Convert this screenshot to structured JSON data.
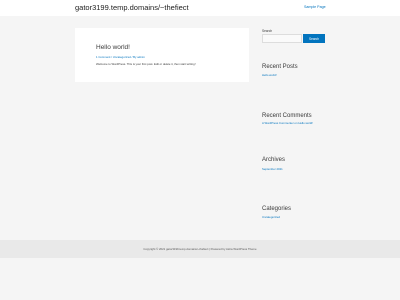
{
  "header": {
    "site_title": "gator3199.temp.domains/~thefiect",
    "nav_link": "Sample Page"
  },
  "post": {
    "title": "Hello world!",
    "meta": "1 Comment / Uncategorized / By admin",
    "excerpt": "Welcome to WordPress. This is your first post. Edit or delete it, then start writing!"
  },
  "sidebar": {
    "search": {
      "label": "Search",
      "placeholder": "",
      "button_label": "Search"
    },
    "recent_posts": {
      "title": "Recent Posts",
      "items": [
        "Hello world!"
      ]
    },
    "recent_comments": {
      "title": "Recent Comments",
      "items": [
        "A WordPress Commenter on Hello world!"
      ]
    },
    "archives": {
      "title": "Archives",
      "items": [
        "September 2021"
      ]
    },
    "categories": {
      "title": "Categories",
      "items": [
        "Uncategorized"
      ]
    }
  },
  "footer": {
    "text": "Copyright © 2021 gator3199.temp.domains/~thefiect | Powered by Astra WordPress Theme"
  },
  "colors": {
    "accent": "#0274be",
    "background": "#f5f5f5",
    "surface": "#ffffff"
  }
}
